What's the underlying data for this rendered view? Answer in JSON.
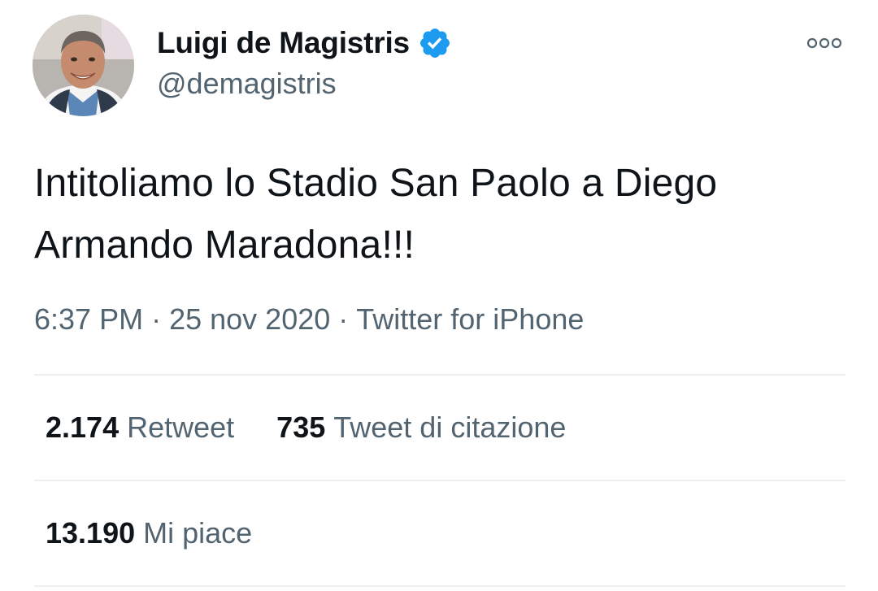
{
  "tweet": {
    "author": {
      "name": "Luigi de Magistris",
      "handle": "@demagistris",
      "verified": true,
      "avatar_icon": "profile-photo"
    },
    "more_icon": "more-options-icon",
    "text": "Intitoliamo lo Stadio San Paolo a Diego Armando Maradona!!!",
    "time": "6:37 PM",
    "date": "25 nov 2020",
    "separator": "·",
    "source": "Twitter for iPhone",
    "stats": {
      "retweets": {
        "count": "2.174",
        "label": "Retweet"
      },
      "quotes": {
        "count": "735",
        "label": "Tweet di citazione"
      },
      "likes": {
        "count": "13.190",
        "label": "Mi piace"
      }
    }
  },
  "colors": {
    "text_primary": "#0f1419",
    "text_secondary": "#536471",
    "verified_blue": "#1d9bf0",
    "divider": "#eceff1"
  }
}
